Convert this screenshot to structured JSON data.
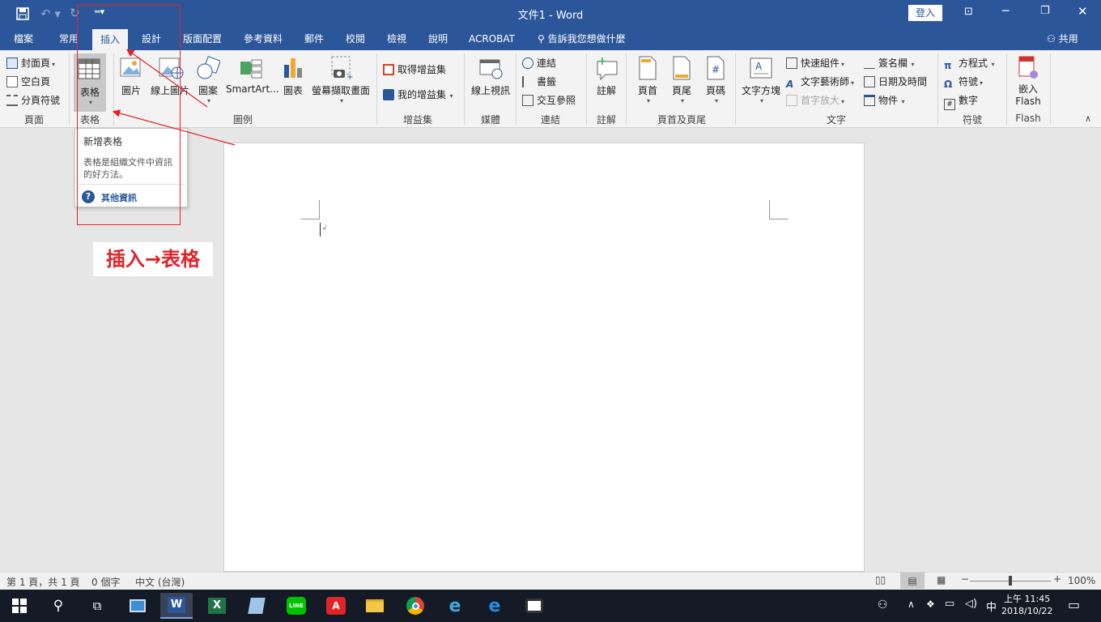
{
  "window": {
    "title": "文件1  -  Word",
    "signin": "登入"
  },
  "tabs": [
    "檔案",
    "常用",
    "插入",
    "設計",
    "版面配置",
    "參考資料",
    "郵件",
    "校閱",
    "檢視",
    "說明",
    "ACROBAT"
  ],
  "tellme": "告訴我您想做什麼",
  "share": "共用",
  "ribbon": {
    "pages": {
      "cover": "封面頁",
      "blank": "空白頁",
      "break": "分頁符號",
      "label": "頁面"
    },
    "tables": {
      "table": "表格",
      "label": "表格"
    },
    "illustrations": {
      "pictures": "圖片",
      "online_pictures": "線上圖片",
      "shapes": "圖案",
      "smartart": "SmartArt...",
      "chart": "圖表",
      "screenshot": "螢幕擷取畫面",
      "label": "圖例"
    },
    "addins": {
      "get": "取得增益集",
      "my": "我的增益集",
      "label": "增益集"
    },
    "media": {
      "online_video": "線上視訊",
      "label": "媒體"
    },
    "links": {
      "link": "連結",
      "bookmark": "書籤",
      "crossref": "交互參照",
      "label": "連結"
    },
    "comments": {
      "comment": "註解",
      "label": "註解"
    },
    "headerfooter": {
      "header": "頁首",
      "footer": "頁尾",
      "pagenum": "頁碼",
      "label": "頁首及頁尾"
    },
    "text": {
      "textbox": "文字方塊",
      "quickparts": "快速組件",
      "wordart": "文字藝術師",
      "dropcap": "首字放大",
      "signature": "簽名欄",
      "datetime": "日期及時間",
      "object": "物件",
      "label": "文字"
    },
    "symbols": {
      "equation": "方程式",
      "symbol": "符號",
      "number": "數字",
      "label": "符號"
    },
    "flash": {
      "embed1": "嵌入",
      "embed2": "Flash",
      "label": "Flash"
    }
  },
  "tooltip": {
    "title": "新增表格",
    "desc1": "表格是組織文件中資訊",
    "desc2": "的好方法。",
    "more": "其他資訊"
  },
  "annotation": {
    "text": "插入→表格"
  },
  "status": {
    "page": "第 1 頁，共 1 頁",
    "words": "0 個字",
    "lang": "中文 (台灣)",
    "zoom": "100%"
  },
  "taskbar": {
    "ime": "中",
    "time": "上午 11:45",
    "date": "2018/10/22"
  },
  "colors": {
    "accent": "#2b579a",
    "annotation": "#e0242a"
  }
}
